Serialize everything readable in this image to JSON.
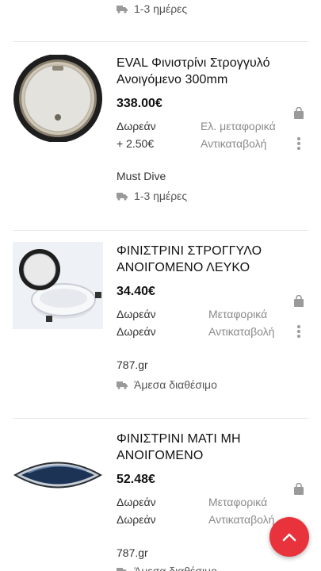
{
  "top_partial": {
    "delivery": "1-3 ημέρες"
  },
  "products": [
    {
      "title": "EVAL Φινιστρίνι Στρογγυλό Ανοιγόμενο 300mm",
      "price": "338.00€",
      "cond_left": [
        "Δωρεάν",
        "+ 2.50€"
      ],
      "cond_right": [
        "Ελ. μεταφορικά",
        "Αντικαταβολή"
      ],
      "seller": "Must Dive",
      "delivery": "1-3 ημέρες",
      "image_icon": "round-porthole-image"
    },
    {
      "title": "ΦΙΝΙΣΤΡΙΝΙ ΣΤΡΟΓΓΥΛΟ ΑΝΟΙΓΟΜΕΝΟ ΛΕΥΚΟ",
      "price": "34.40€",
      "cond_left": [
        "Δωρεάν",
        "Δωρεάν"
      ],
      "cond_right": [
        "Μεταφορικά",
        "Αντικαταβολή"
      ],
      "seller": "787.gr",
      "delivery": "Άμεσα διαθέσιμο",
      "image_icon": "white-opening-porthole-image"
    },
    {
      "title": "ΦΙΝΙΣΤΡΙΝΙ ΜΑΤΙ ΜΗ ΑΝΟΙΓΟΜΕΝΟ",
      "price": "52.48€",
      "cond_left": [
        "Δωρεάν",
        "Δωρεάν"
      ],
      "cond_right": [
        "Μεταφορικά",
        "Αντικαταβολή"
      ],
      "seller": "787.gr",
      "delivery": "Άμεσα διαθέσιμο",
      "image_icon": "eye-shaped-porthole-image"
    }
  ],
  "icons": {
    "cart": "shopping-bag-icon",
    "more": "more-vertical-icon",
    "truck": "truck-icon",
    "scroll_top": "chevron-up-icon"
  },
  "colors": {
    "accent": "#e8323c",
    "muted": "#8a8a8a"
  }
}
